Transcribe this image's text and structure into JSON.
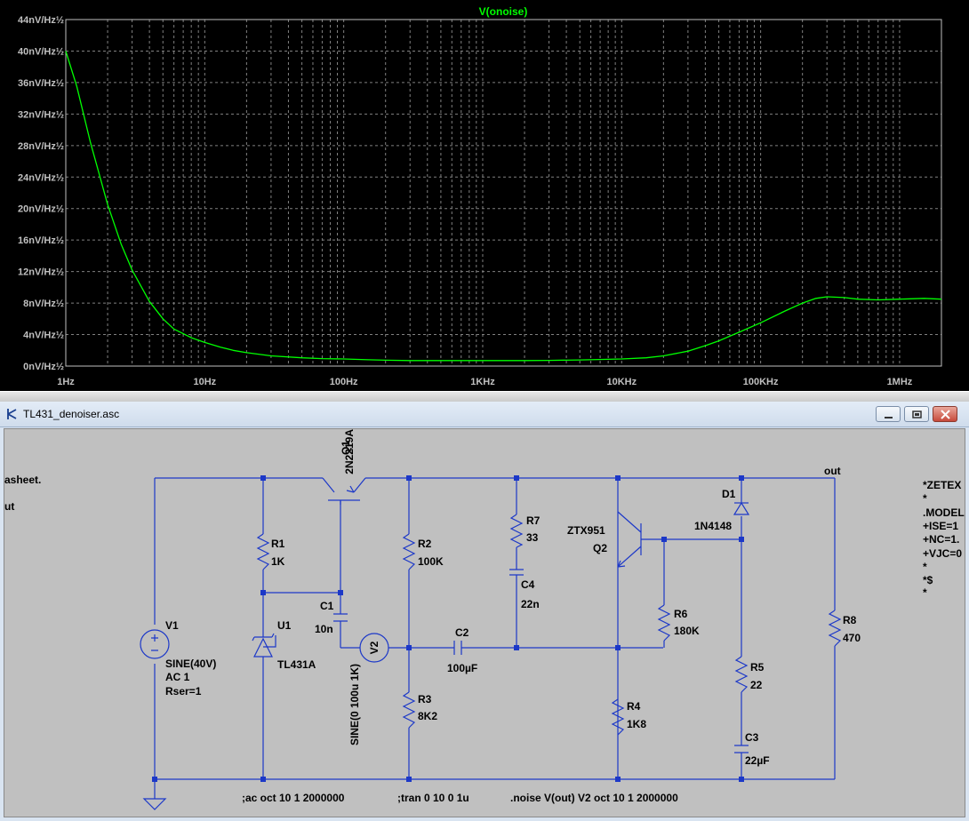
{
  "plot": {
    "trace_label": "V(onoise)",
    "colors": {
      "background": "#000000",
      "grid": "#808080",
      "trace": "#00ff00",
      "axis_text": "#c0c0c0"
    }
  },
  "chart_data": {
    "type": "line",
    "title": "V(onoise)",
    "x_scale": "log",
    "xlim": [
      1,
      2000000
    ],
    "ylim": [
      0,
      44
    ],
    "x_ticks": [
      "1Hz",
      "10Hz",
      "100Hz",
      "1KHz",
      "10KHz",
      "100KHz",
      "1MHz"
    ],
    "x_tick_values": [
      1,
      10,
      100,
      1000,
      10000,
      100000,
      1000000
    ],
    "y_ticks": [
      "0nV/Hz½",
      "4nV/Hz½",
      "8nV/Hz½",
      "12nV/Hz½",
      "16nV/Hz½",
      "20nV/Hz½",
      "24nV/Hz½",
      "28nV/Hz½",
      "32nV/Hz½",
      "36nV/Hz½",
      "40nV/Hz½",
      "44nV/Hz½"
    ],
    "y_tick_values": [
      0,
      4,
      8,
      12,
      16,
      20,
      24,
      28,
      32,
      36,
      40,
      44
    ],
    "grid": true,
    "series": [
      {
        "name": "V(onoise)",
        "x": [
          1,
          1.2,
          1.5,
          2,
          2.5,
          3,
          4,
          5,
          6,
          8,
          10,
          13,
          16,
          20,
          30,
          50,
          70,
          100,
          150,
          200,
          300,
          500,
          1000,
          2000,
          3000,
          5000,
          10000,
          15000,
          20000,
          30000,
          40000,
          50000,
          70000,
          100000,
          150000,
          200000,
          250000,
          300000,
          400000,
          500000,
          700000,
          1000000,
          1500000,
          2000000
        ],
        "y": [
          40,
          35.5,
          28.5,
          20.5,
          15.5,
          12.2,
          8.2,
          6.0,
          4.7,
          3.6,
          3.0,
          2.4,
          2.0,
          1.7,
          1.3,
          1.05,
          0.95,
          0.9,
          0.8,
          0.75,
          0.7,
          0.7,
          0.7,
          0.7,
          0.72,
          0.78,
          0.9,
          1.05,
          1.3,
          1.9,
          2.6,
          3.2,
          4.3,
          5.5,
          7.0,
          8.0,
          8.6,
          8.8,
          8.7,
          8.5,
          8.4,
          8.5,
          8.6,
          8.5
        ]
      }
    ]
  },
  "window": {
    "title": "TL431_denoiser.asc"
  },
  "schematic": {
    "net_out": "out",
    "components": {
      "Q1": {
        "ref": "Q1",
        "value": "2N2219A"
      },
      "Q2": {
        "ref": "Q2",
        "value": "ZTX951"
      },
      "R1": {
        "ref": "R1",
        "value": "1K"
      },
      "R2": {
        "ref": "R2",
        "value": "100K"
      },
      "R3": {
        "ref": "R3",
        "value": "8K2"
      },
      "R4": {
        "ref": "R4",
        "value": "1K8"
      },
      "R5": {
        "ref": "R5",
        "value": "22"
      },
      "R6": {
        "ref": "R6",
        "value": "180K"
      },
      "R7": {
        "ref": "R7",
        "value": "33"
      },
      "R8": {
        "ref": "R8",
        "value": "470"
      },
      "C1": {
        "ref": "C1",
        "value": "10n"
      },
      "C2": {
        "ref": "C2",
        "value": "100µF"
      },
      "C3": {
        "ref": "C3",
        "value": "22µF"
      },
      "C4": {
        "ref": "C4",
        "value": "22n"
      },
      "D1": {
        "ref": "D1",
        "value": "1N4148"
      },
      "U1": {
        "ref": "U1",
        "value": "TL431A"
      },
      "V1": {
        "ref": "V1",
        "line1": "SINE(40V)",
        "line2": "AC 1",
        "line3": "Rser=1"
      },
      "V2": {
        "ref": "V2",
        "value": "SINE(0 100u 1K)"
      }
    },
    "directives": {
      "ac": ";ac oct 10 1 2000000",
      "tran": ";tran 0 10 0 1u",
      "noise": ".noise V(out) V2 oct 10 1 2000000"
    },
    "left_clipped": [
      "asheet.",
      "ut"
    ],
    "right_model": [
      "*ZETEX",
      "*",
      ".MODEL",
      "+ISE=1",
      "+NC=1.",
      "+VJC=0",
      "*",
      "*$",
      "*"
    ]
  }
}
